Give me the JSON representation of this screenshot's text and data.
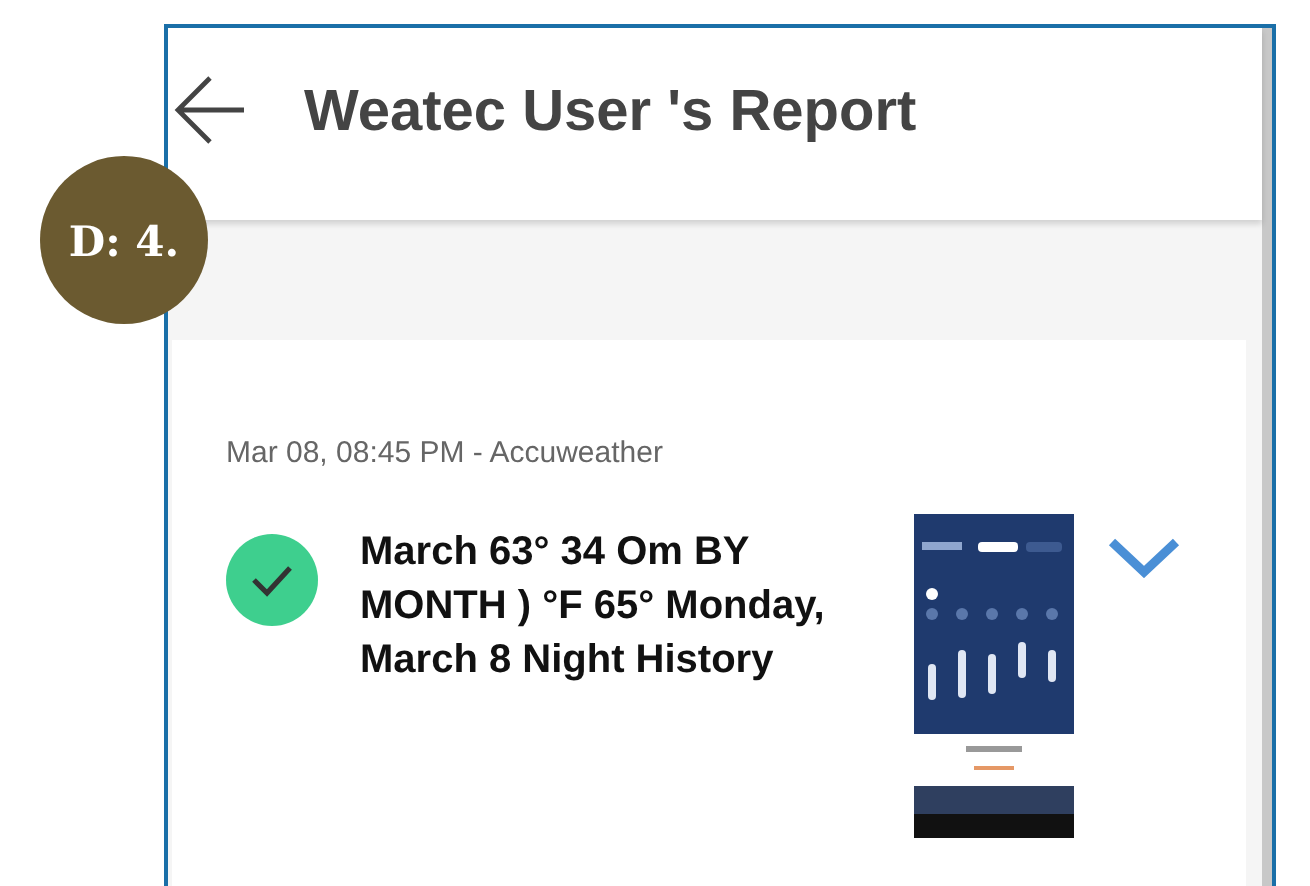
{
  "badge": {
    "label": "D: 4."
  },
  "header": {
    "title": "Weatec User 's Report"
  },
  "report": {
    "meta": "Mar 08, 08:45 PM - Accuweather",
    "checked": true,
    "text": "March 63° 34 Om BY MONTH ) °F 65° Monday, March 8 Night History"
  }
}
